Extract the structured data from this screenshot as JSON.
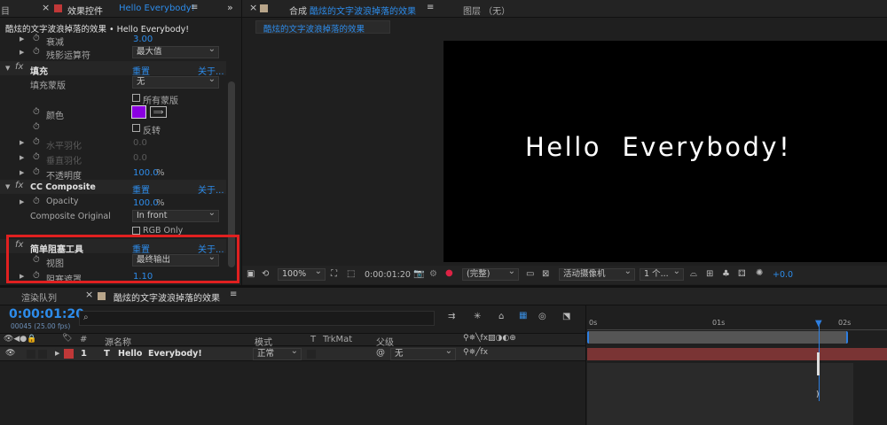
{
  "effect_panel": {
    "tab_left_cut": "目",
    "tab_title_prefix": "效果控件",
    "tab_title_layer": "Hello Everybody!",
    "breadcrumb": "酷炫的文字波浪掉落的效果 • Hello Everybody!",
    "rows": {
      "decay_label": "衰减",
      "decay_value": "3.00",
      "residual_label": "残影运算符",
      "residual_value": "最大值",
      "fill_fx": "填充",
      "reset": "重置",
      "about": "关于...",
      "fill_mask_label": "填充蒙版",
      "fill_mask_value": "无",
      "all_masks": "所有蒙版",
      "color_label": "颜色",
      "invert": "反转",
      "h_feather": "水平羽化",
      "h_feather_value": "0.0",
      "v_feather": "垂直羽化",
      "v_feather_value": "0.0",
      "opacity_cn": "不透明度",
      "opacity_cn_value": "100.0",
      "cc_fx": "CC Composite",
      "opacity_en": "Opacity",
      "opacity_en_value": "100.0",
      "percent": "%",
      "composite_label": "Composite Original",
      "composite_value": "In front",
      "rgb_only": "RGB Only",
      "matte_fx": "简单阻塞工具",
      "view_label": "视图",
      "view_value": "最终输出",
      "choke_label": "阻塞遮罩",
      "choke_value": "1.10"
    },
    "fill_color": "#8a00e0"
  },
  "comp_panel": {
    "tab_prefix": "合成",
    "tab_title": "酷炫的文字波浪掉落的效果",
    "layer_tab": "图层 （无）",
    "sub_tab": "酷炫的文字波浪掉落的效果",
    "viewer_text": "Hello  Everybody!",
    "zoom": "100%",
    "timecode": "0:00:01:20",
    "resolution": "(完整)",
    "camera": "活动摄像机",
    "views": "1 个...",
    "exposure": "+0.0"
  },
  "timeline": {
    "render_queue": "渲染队列",
    "comp_tab": "酷炫的文字波浪掉落的效果",
    "timecode": "0:00:01:20",
    "frame_info": "00045 (25.00 fps)",
    "search_placeholder": "",
    "cols": {
      "hash": "#",
      "source": "源名称",
      "mode": "模式",
      "t": "T",
      "trkmat": "TrkMat",
      "parent": "父级"
    },
    "layer": {
      "index": "1",
      "type": "T",
      "name": "Hello  Everybody!",
      "mode": "正常",
      "parent": "无"
    },
    "ruler": [
      "0s",
      "01s",
      "02s"
    ]
  }
}
